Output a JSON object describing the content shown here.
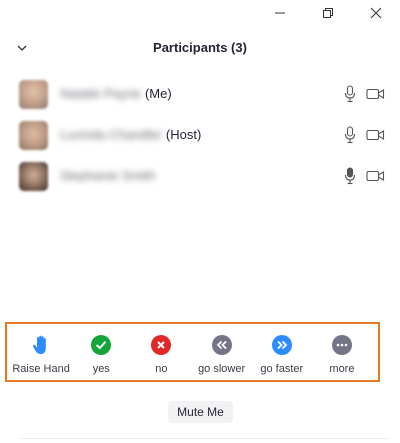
{
  "window": {
    "minimize_icon": "minimize-icon",
    "restore_icon": "restore-icon",
    "close_icon": "close-icon"
  },
  "header": {
    "collapse_icon": "chevron-down-icon",
    "title": "Participants (3)"
  },
  "participants": [
    {
      "name": "Natalie Payne",
      "role": "(Me)",
      "mic": "mic-icon",
      "video": "video-icon",
      "avatar_color": "#c9a58f"
    },
    {
      "name": "Lucinda Chandler",
      "role": "(Host)",
      "mic": "mic-icon",
      "video": "video-icon",
      "avatar_color": "#c4a08a"
    },
    {
      "name": "Stephanie Smith",
      "role": "",
      "mic": "mic-icon",
      "video": "video-icon",
      "avatar_color": "#9e7f6e"
    }
  ],
  "reactions": [
    {
      "label": "Raise Hand",
      "icon": "raise-hand-icon",
      "color": "#2d8cff"
    },
    {
      "label": "yes",
      "icon": "check-icon",
      "color": "#13a538"
    },
    {
      "label": "no",
      "icon": "x-icon",
      "color": "#e02828"
    },
    {
      "label": "go slower",
      "icon": "double-chevron-left-icon",
      "color": "#747487"
    },
    {
      "label": "go faster",
      "icon": "double-chevron-right-icon",
      "color": "#2d8cff"
    },
    {
      "label": "more",
      "icon": "more-icon",
      "color": "#747487"
    }
  ],
  "mute_button": {
    "label": "Mute Me"
  },
  "colors": {
    "highlight_border": "#e87722",
    "accent_blue": "#2d8cff",
    "green": "#13a538",
    "red": "#e02828",
    "gray": "#747487"
  }
}
